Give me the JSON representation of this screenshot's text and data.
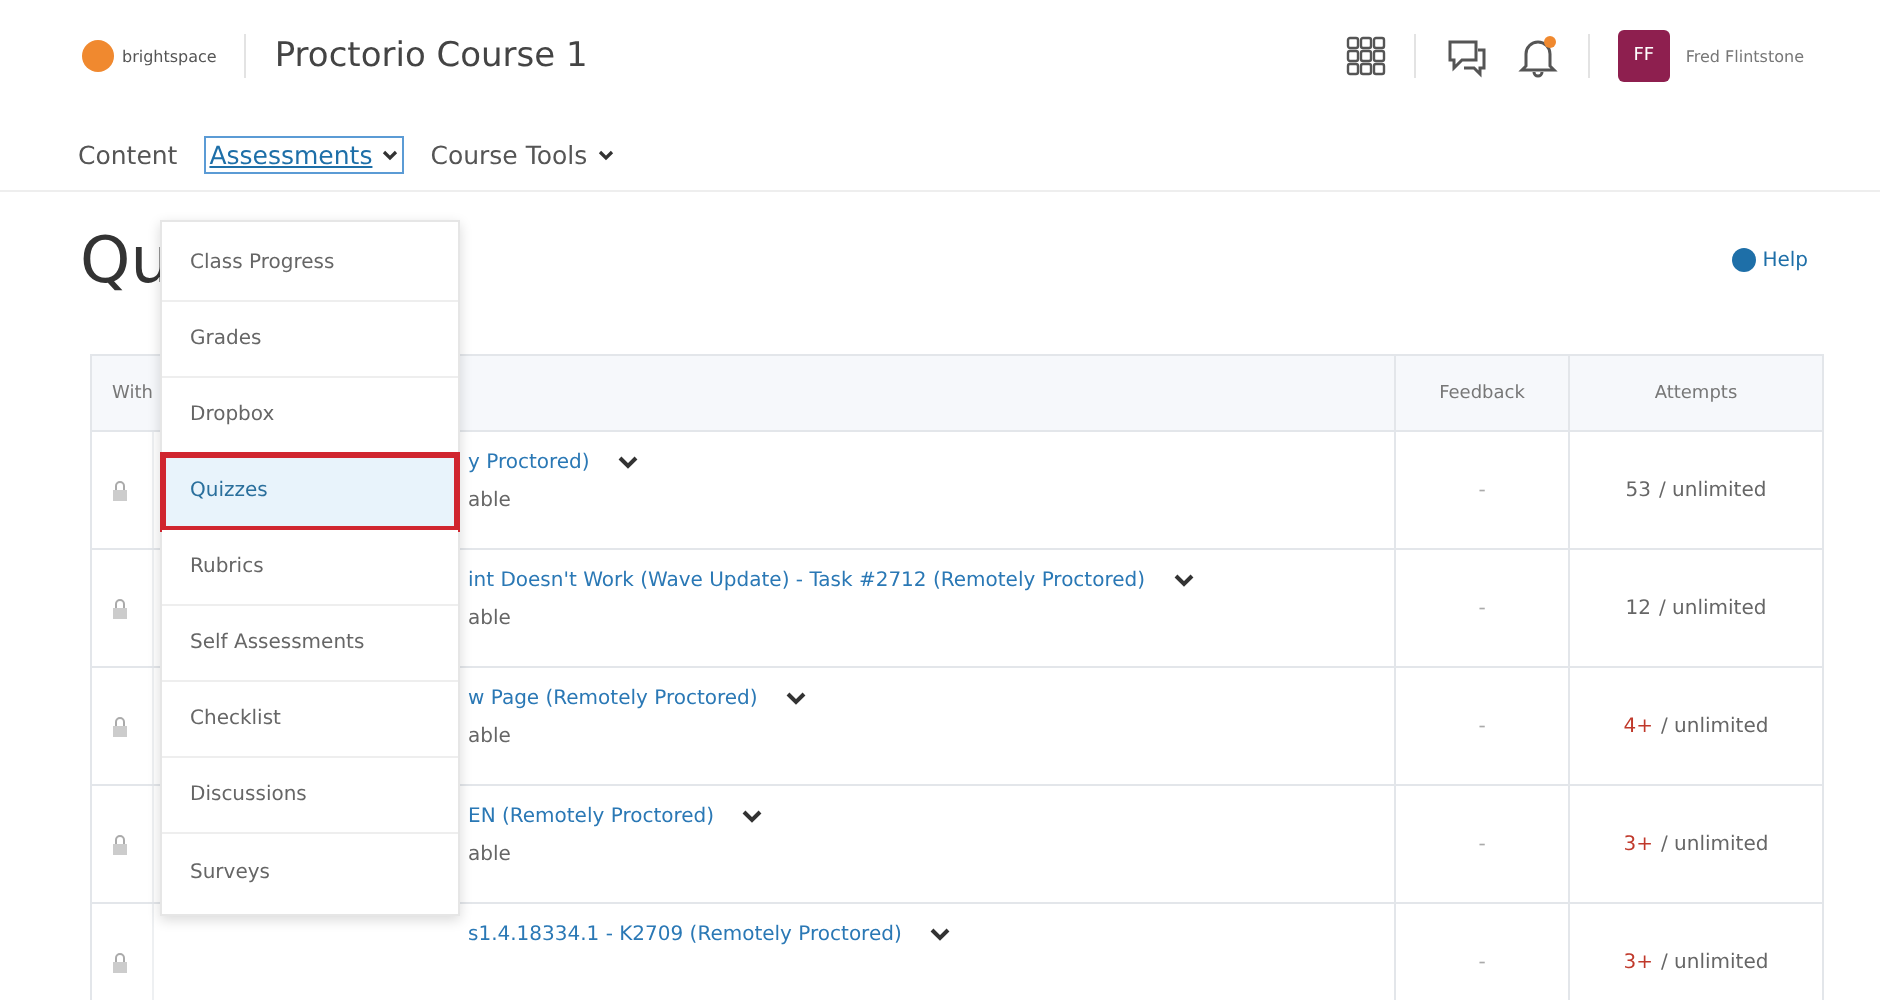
{
  "header": {
    "logo_text": "brightspace",
    "course_title": "Proctorio Course 1",
    "notification_dot": true,
    "avatar_initials": "FF",
    "user_name": "Fred Flintstone"
  },
  "nav": [
    {
      "label": "Content",
      "has_menu": false,
      "selected": false
    },
    {
      "label": "Assessments",
      "has_menu": true,
      "selected": true
    },
    {
      "label": "Course Tools",
      "has_menu": true,
      "selected": false
    }
  ],
  "page_title": "Qu",
  "help_link": "Help",
  "dropdown": [
    {
      "label": "Class Progress",
      "selected": false
    },
    {
      "label": "Grades",
      "selected": false
    },
    {
      "label": "Dropbox",
      "selected": false
    },
    {
      "label": "Quizzes",
      "selected": true
    },
    {
      "label": "Rubrics",
      "selected": false
    },
    {
      "label": "Self Assessments",
      "selected": false
    },
    {
      "label": "Checklist",
      "selected": false
    },
    {
      "label": "Discussions",
      "selected": false
    },
    {
      "label": "Surveys",
      "selected": false
    }
  ],
  "table": {
    "columns": [
      "With",
      "Feedback",
      "Attempts"
    ],
    "rows": [
      {
        "name": "y Proctored)",
        "status": "able",
        "feedback": "-",
        "attempts_count": "53",
        "attempts_limit": "/ unlimited",
        "flagged": false
      },
      {
        "name": "int Doesn't Work (Wave Update) - Task #2712 (Remotely Proctored)",
        "status": "able",
        "feedback": "-",
        "attempts_count": "12",
        "attempts_limit": "/ unlimited",
        "flagged": false
      },
      {
        "name": "w Page (Remotely Proctored)",
        "status": "able",
        "feedback": "-",
        "attempts_count": "4+",
        "attempts_limit": "/ unlimited",
        "flagged": true
      },
      {
        "name": "EN (Remotely Proctored)",
        "status": "able",
        "feedback": "-",
        "attempts_count": "3+",
        "attempts_limit": "/ unlimited",
        "flagged": true
      },
      {
        "name": "s1.4.18334.1 - K2709 (Remotely Proctored)",
        "feedback": "-",
        "attempts_count": "3+",
        "attempts_limit": "/ unlimited",
        "flagged": true
      }
    ]
  }
}
